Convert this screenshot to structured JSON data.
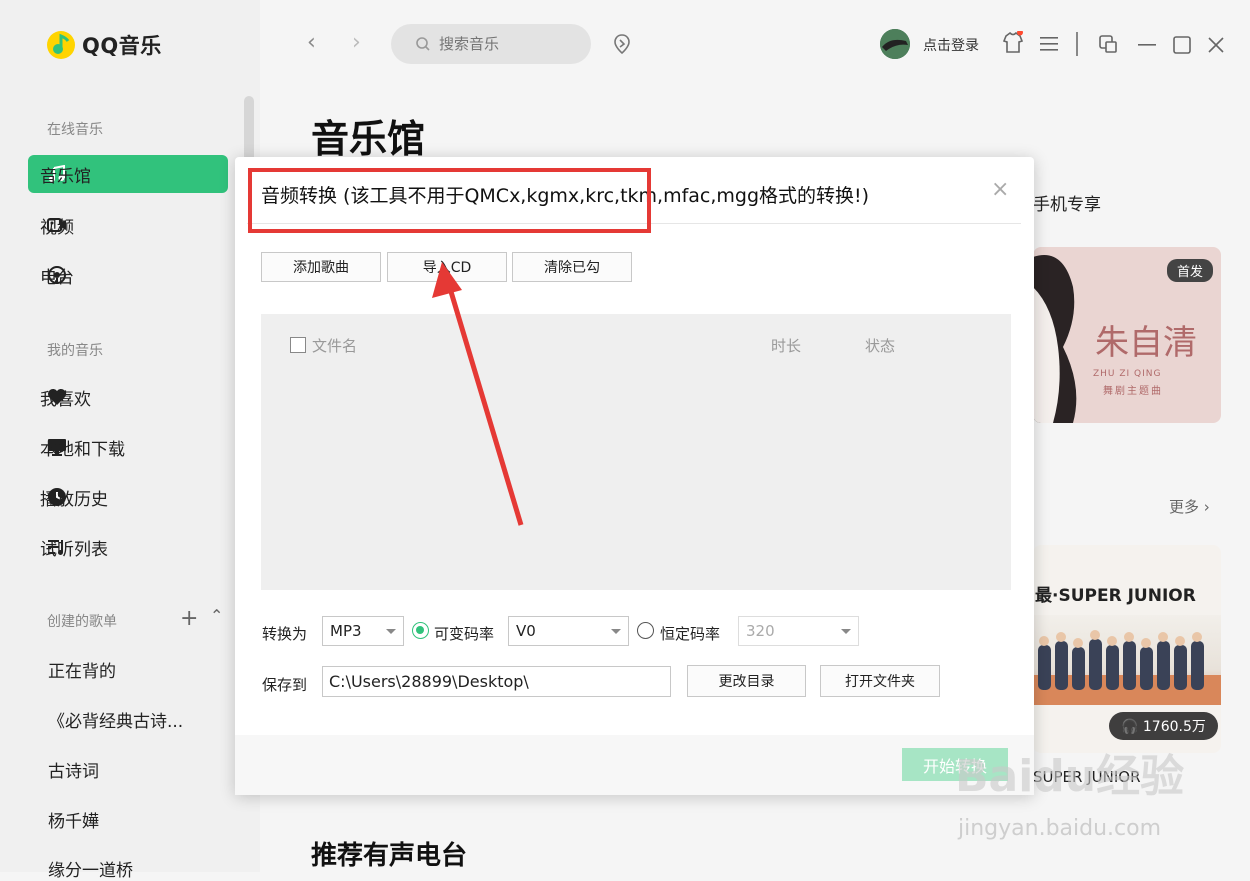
{
  "app": {
    "logo_text": "QQ音乐"
  },
  "sidebar": {
    "online_section": "在线音乐",
    "online_items": [
      {
        "label": "音乐馆",
        "icon": "music-note-icon",
        "active": true
      },
      {
        "label": "视频",
        "icon": "video-icon"
      },
      {
        "label": "电台",
        "icon": "radio-icon"
      }
    ],
    "my_section": "我的音乐",
    "my_items": [
      {
        "label": "我喜欢",
        "icon": "heart-icon"
      },
      {
        "label": "本地和下载",
        "icon": "monitor-icon"
      },
      {
        "label": "播放历史",
        "icon": "clock-icon"
      },
      {
        "label": "试听列表",
        "icon": "playlist-icon"
      }
    ],
    "created_section": "创建的歌单",
    "add_symbol": "+",
    "collapse_symbol": "⌃",
    "playlists": [
      "正在背的",
      "《必背经典古诗...",
      "古诗词",
      "杨千嬅",
      "缘分一道桥"
    ]
  },
  "topbar": {
    "search_placeholder": "搜索音乐",
    "login_text": "点击登录",
    "back_symbol": "‹",
    "forward_symbol": "›"
  },
  "main": {
    "page_title": "音乐馆",
    "phone_exclusive": "手机专享",
    "card1": {
      "badge": "首发",
      "name": "朱自清",
      "sub_pinyin": "ZHU ZI QING",
      "sub_text": "舞剧主题曲"
    },
    "more_text": "更多",
    "card2": {
      "title": "最·SUPER JUNIOR",
      "plays": "1760.5万",
      "caption": "SUPER JUNIOR"
    },
    "bottom_title": "推荐有声电台"
  },
  "dialog": {
    "title": "音频转换 (该工具不用于QMCx,kgmx,krc,tkm,mfac,mgg格式的转换!)",
    "close_symbol": "×",
    "buttons": {
      "add_song": "添加歌曲",
      "import_cd": "导入CD",
      "clear_checked": "清除已勾"
    },
    "columns": {
      "file_name": "文件名",
      "duration": "时长",
      "status": "状态"
    },
    "convert_to_label": "转换为",
    "format_value": "MP3",
    "variable_bitrate_label": "可变码率",
    "variable_bitrate_value": "V0",
    "constant_bitrate_label": "恒定码率",
    "constant_bitrate_value": "320",
    "save_to_label": "保存到",
    "save_path": "C:\\Users\\28899\\Desktop\\",
    "change_dir_button": "更改目录",
    "open_folder_button": "打开文件夹",
    "start_button": "开始转换"
  },
  "watermark": {
    "main": "Baidu经验",
    "sub": "jingyan.baidu.com"
  },
  "colors": {
    "accent": "#31c27c",
    "annotation": "#e53935"
  }
}
